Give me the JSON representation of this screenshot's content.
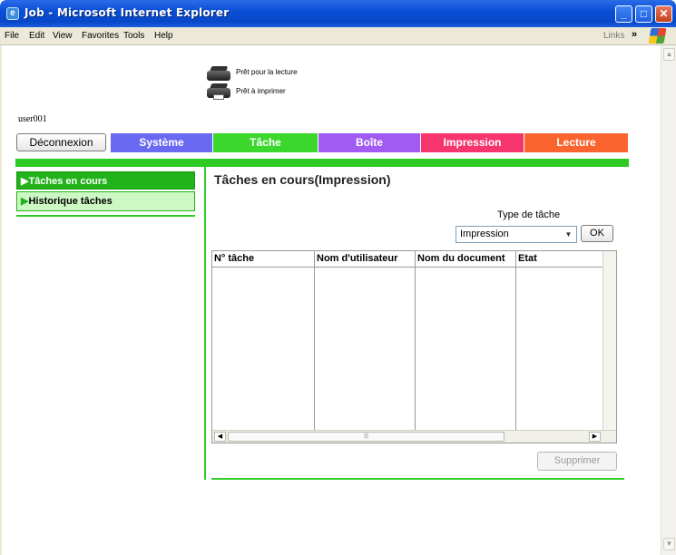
{
  "window": {
    "title": "Job - Microsoft Internet Explorer"
  },
  "menu": {
    "items": [
      "File",
      "Edit",
      "View",
      "Favorites",
      "Tools",
      "Help"
    ],
    "links": "Links"
  },
  "status": {
    "read": "Prêt pour la lecture",
    "print": "Prêt à imprimer"
  },
  "user": "user001",
  "nav": {
    "logout": "Déconnexion",
    "tabs": [
      {
        "label": "Système",
        "color": "#6a69f2"
      },
      {
        "label": "Tâche",
        "color": "#3cd72d"
      },
      {
        "label": "Boîte",
        "color": "#a15bf2"
      },
      {
        "label": "Impression",
        "color": "#f6356f"
      },
      {
        "label": "Lecture",
        "color": "#f9642f"
      }
    ]
  },
  "sidebar": {
    "items": [
      {
        "label": "Tâches en cours"
      },
      {
        "label": "Historique tâches"
      }
    ]
  },
  "main": {
    "title": "Tâches en cours(Impression)",
    "type_label": "Type de tâche",
    "type_value": "Impression",
    "ok": "OK",
    "columns": [
      "N° tâche",
      "Nom d'utilisateur",
      "Nom du document",
      "Etat"
    ],
    "delete": "Supprimer"
  },
  "colors": {
    "accent_green": "#2fcb25",
    "titlebar_blue": "#0a4fd6"
  }
}
